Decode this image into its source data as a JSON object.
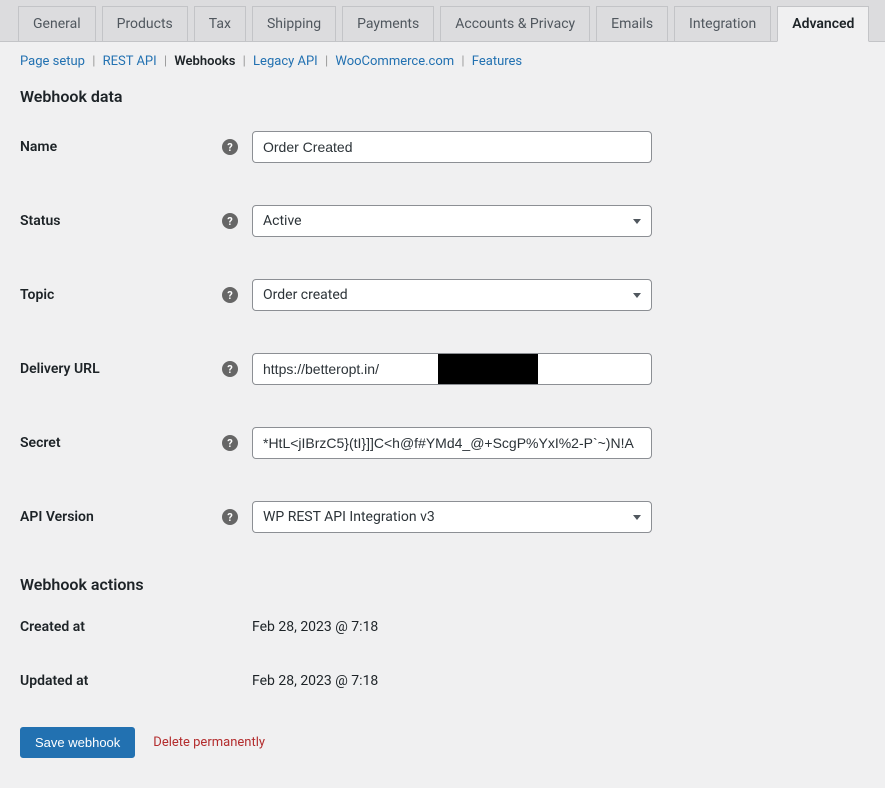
{
  "tabs": [
    {
      "label": "General"
    },
    {
      "label": "Products"
    },
    {
      "label": "Tax"
    },
    {
      "label": "Shipping"
    },
    {
      "label": "Payments"
    },
    {
      "label": "Accounts & Privacy"
    },
    {
      "label": "Emails"
    },
    {
      "label": "Integration"
    },
    {
      "label": "Advanced",
      "active": true
    }
  ],
  "subnav": [
    {
      "label": "Page setup",
      "link": true
    },
    {
      "label": "REST API",
      "link": true
    },
    {
      "label": "Webhooks",
      "current": true
    },
    {
      "label": "Legacy API",
      "link": true
    },
    {
      "label": "WooCommerce.com",
      "link": true
    },
    {
      "label": "Features",
      "link": true
    }
  ],
  "sections": {
    "data_title": "Webhook data",
    "actions_title": "Webhook actions"
  },
  "fields": {
    "name": {
      "label": "Name",
      "value": "Order Created"
    },
    "status": {
      "label": "Status",
      "value": "Active"
    },
    "topic": {
      "label": "Topic",
      "value": "Order created"
    },
    "delivery_url": {
      "label": "Delivery URL",
      "value": "https://betteropt.in/"
    },
    "secret": {
      "label": "Secret",
      "value": "*HtL<jIBrzC5}(tI}]]C<h@f#YMd4_@+ScgP%YxI%2-P`~)N!A"
    },
    "api_version": {
      "label": "API Version",
      "value": "WP REST API Integration v3"
    }
  },
  "info": {
    "created_at": {
      "label": "Created at",
      "value": "Feb 28, 2023 @ 7:18"
    },
    "updated_at": {
      "label": "Updated at",
      "value": "Feb 28, 2023 @ 7:18"
    }
  },
  "buttons": {
    "save": "Save webhook",
    "delete": "Delete permanently"
  }
}
